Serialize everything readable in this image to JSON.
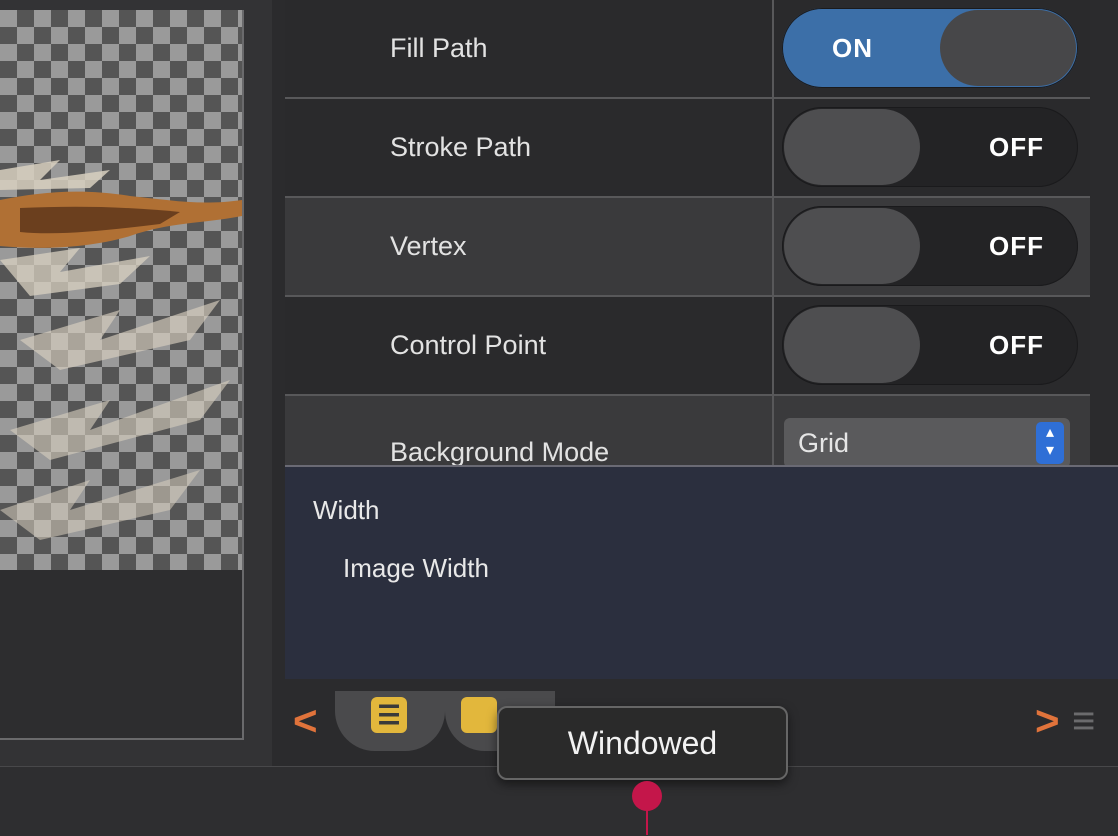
{
  "settings": {
    "rows": [
      {
        "label": "Fill Path",
        "state": "ON"
      },
      {
        "label": "Stroke Path",
        "state": "OFF"
      },
      {
        "label": "Vertex",
        "state": "OFF"
      },
      {
        "label": "Control Point",
        "state": "OFF"
      }
    ],
    "background_mode": {
      "label": "Background Mode",
      "value": "Grid",
      "stepper_icon": "up-down-chevron-icon"
    }
  },
  "info": {
    "title": "Width",
    "subtitle": "Image Width"
  },
  "toolbar": {
    "prev_icon": "chevron-left-icon",
    "next_icon": "chevron-right-icon",
    "list_icon": "list-icon",
    "grid_icon": "document-icon",
    "menu_icon": "hamburger-menu-icon"
  },
  "tooltip": {
    "text": "Windowed"
  },
  "colors": {
    "toggle_on": "#3c6fa8",
    "accent_orange": "#e0733b",
    "tab_icon": "#e2b73c",
    "cursor": "#c4164a",
    "select_stepper": "#2f6fd6"
  }
}
